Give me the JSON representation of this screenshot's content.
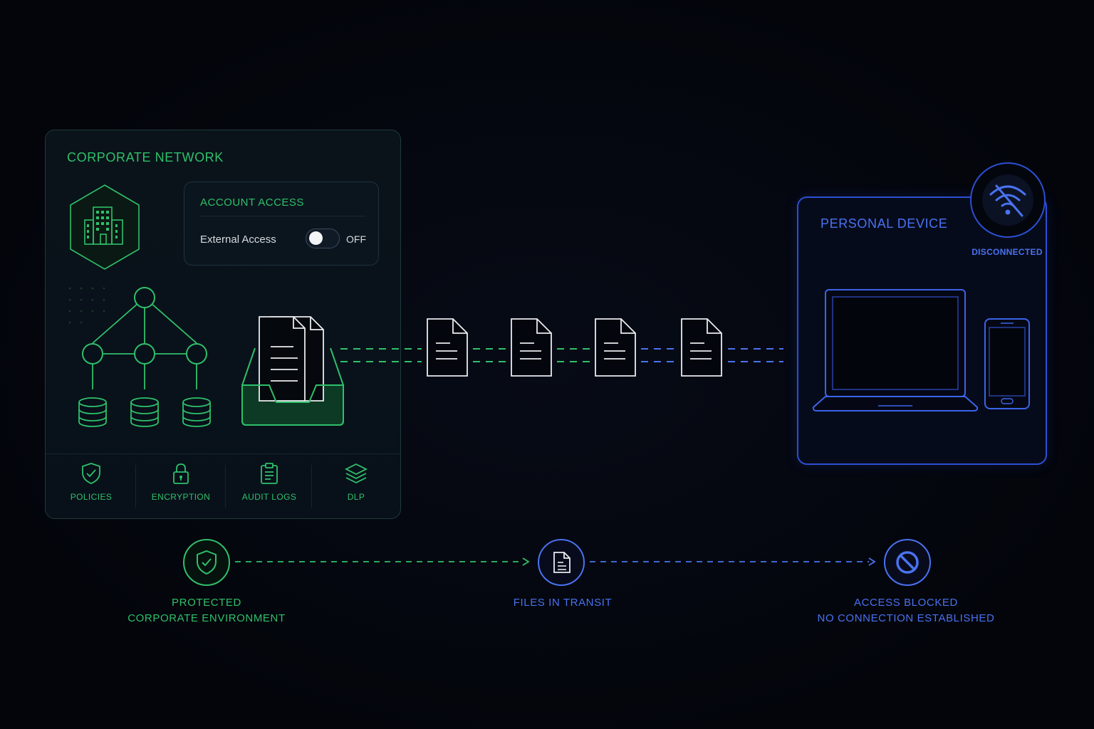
{
  "corporate_network": {
    "title": "CORPORATE NETWORK",
    "account_access": {
      "title": "ACCOUNT ACCESS",
      "external_access_label": "External Access",
      "toggle_state": "OFF"
    },
    "features": [
      {
        "label": "POLICIES",
        "icon": "shield-check-icon"
      },
      {
        "label": "ENCRYPTION",
        "icon": "padlock-icon"
      },
      {
        "label": "AUDIT LOGS",
        "icon": "clipboard-icon"
      },
      {
        "label": "DLP",
        "icon": "layers-icon"
      }
    ]
  },
  "personal_device": {
    "title": "PERSONAL DEVICE",
    "connection_status": "DISCONNECTED"
  },
  "flow": {
    "protected": {
      "line1": "PROTECTED",
      "line2": "CORPORATE ENVIRONMENT"
    },
    "transit": {
      "line1": "FILES IN TRANSIT"
    },
    "blocked": {
      "line1": "ACCESS BLOCKED",
      "line2": "NO CONNECTION ESTABLISHED"
    }
  },
  "colors": {
    "corporate_accent": "#2fc06a",
    "personal_accent": "#4a72f0",
    "background": "#04060d",
    "document": "#e8ecef"
  }
}
